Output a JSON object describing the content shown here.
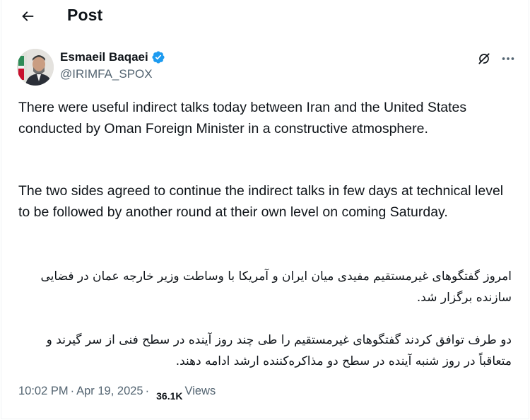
{
  "header": {
    "back_icon": "arrow-left-icon",
    "title": "Post"
  },
  "author": {
    "name": "Esmaeil Baqaei",
    "handle": "@IRIMFA_SPOX",
    "verified_icon": "verified-badge-icon",
    "verified_color": "#1d9bf0"
  },
  "actions": {
    "grok_icon": "grok-icon",
    "more_icon": "more-horizontal-icon"
  },
  "post": {
    "paragraph_1": "There were useful indirect talks today between Iran and the United States conducted by Oman Foreign Minister in a constructive atmosphere.",
    "paragraph_2": "The two sides agreed to continue the indirect talks in few days at technical level to be followed by another round at their own level on coming Saturday.",
    "paragraph_3": "امروز گفتگوهای غیرمستقیم مفیدی میان ایران و آمریکا با وساطت وزیر خارجه عمان در فضایی سازنده برگزار شد.",
    "paragraph_4": "دو طرف توافق کردند گفتگوهای غیرمستقیم را طی چند روز آینده در سطح فنی از سر گیرند و متعاقباً در روز شنبه آینده در سطح دو مذاکره‌کننده ارشد ادامه دهند."
  },
  "meta": {
    "time": "10:02 PM",
    "separator": "·",
    "date": "Apr 19, 2025",
    "views_count": "36.1K",
    "views_label": "Views"
  },
  "colors": {
    "text": "#0f1419",
    "secondary": "#536471",
    "accent": "#1d9bf0"
  }
}
